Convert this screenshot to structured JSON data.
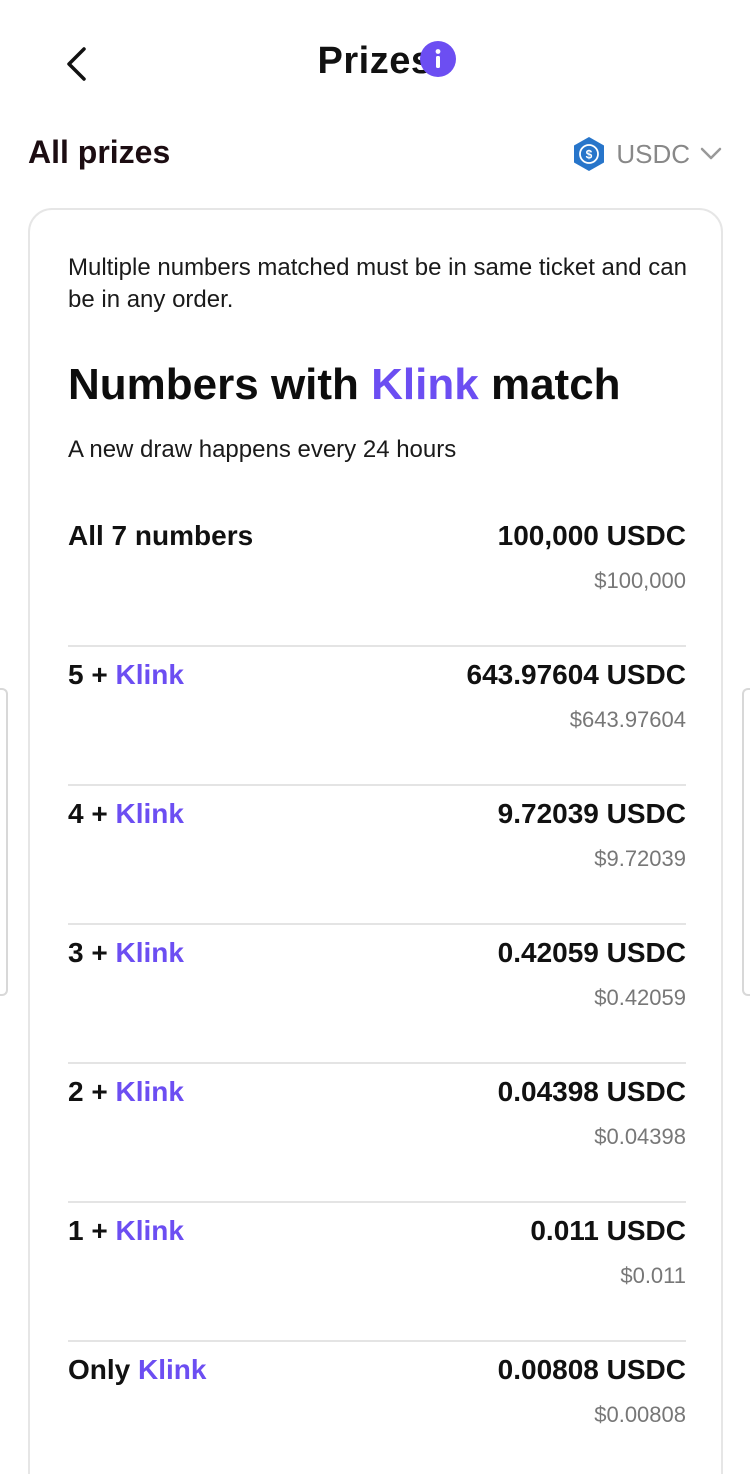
{
  "header": {
    "title": "Prizes",
    "back_icon": "chevron-left-icon",
    "info_icon": "info-icon"
  },
  "section": {
    "title": "All prizes",
    "currency": {
      "label": "USDC",
      "icon": "usdc-coin-icon",
      "chevron_icon": "chevron-down-icon"
    }
  },
  "card": {
    "note": "Multiple numbers matched must be in same ticket and can be in any order.",
    "headline_prefix": "Numbers with ",
    "headline_accent": "Klink",
    "headline_suffix": " match",
    "draw_note": "A new draw happens every 24 hours"
  },
  "prizes": [
    {
      "label_main": "All 7 numbers",
      "label_accent": "",
      "amount": "100,000 USDC",
      "usd": "$100,000"
    },
    {
      "label_main": "5 + ",
      "label_accent": "Klink",
      "amount": "643.97604 USDC",
      "usd": "$643.97604"
    },
    {
      "label_main": "4 + ",
      "label_accent": "Klink",
      "amount": "9.72039 USDC",
      "usd": "$9.72039"
    },
    {
      "label_main": "3 + ",
      "label_accent": "Klink",
      "amount": "0.42059 USDC",
      "usd": "$0.42059"
    },
    {
      "label_main": "2 + ",
      "label_accent": "Klink",
      "amount": "0.04398 USDC",
      "usd": "$0.04398"
    },
    {
      "label_main": "1 + ",
      "label_accent": "Klink",
      "amount": "0.011 USDC",
      "usd": "$0.011"
    },
    {
      "label_main": "Only ",
      "label_accent": "Klink",
      "amount": "0.00808 USDC",
      "usd": "$0.00808"
    }
  ],
  "colors": {
    "accent": "#6c4ef2",
    "usdc_blue": "#2775ca",
    "text": "#111111",
    "muted": "#777777"
  }
}
